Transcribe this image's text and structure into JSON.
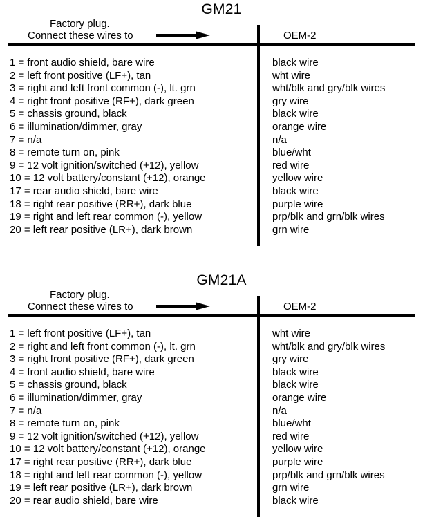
{
  "page": {
    "background_color": "#ffffff",
    "text_color": "#000000",
    "rule_color": "#000000"
  },
  "charts": [
    {
      "id": "gm21",
      "title": "GM21",
      "header": {
        "left_line1": "Factory plug.",
        "left_line2": "Connect these wires to",
        "arrow_icon": "right-arrow-icon",
        "right_label": "OEM-2"
      },
      "columns": [
        "Connect these wires to",
        "OEM-2"
      ],
      "rows": [
        {
          "pin": "1",
          "factory": "1 = front audio shield, bare wire",
          "oem": "black wire"
        },
        {
          "pin": "2",
          "factory": "2 = left front positive (LF+), tan",
          "oem": "wht wire"
        },
        {
          "pin": "3",
          "factory": "3 = right and left front common (-), lt. grn",
          "oem": "wht/blk and gry/blk wires"
        },
        {
          "pin": "4",
          "factory": "4 = right front positive (RF+), dark green",
          "oem": "gry wire"
        },
        {
          "pin": "5",
          "factory": "5 = chassis ground, black",
          "oem": "black wire"
        },
        {
          "pin": "6",
          "factory": "6 = illumination/dimmer, gray",
          "oem": "orange wire"
        },
        {
          "pin": "7",
          "factory": "7 = n/a",
          "oem": "n/a"
        },
        {
          "pin": "8",
          "factory": "8 = remote turn on, pink",
          "oem": "blue/wht"
        },
        {
          "pin": "9",
          "factory": "9 = 12 volt ignition/switched (+12), yellow",
          "oem": "red wire"
        },
        {
          "pin": "10",
          "factory": "10 = 12 volt battery/constant (+12), orange",
          "oem": "yellow wire"
        },
        {
          "pin": "17",
          "factory": "17 = rear audio shield, bare wire",
          "oem": "black wire"
        },
        {
          "pin": "18",
          "factory": "18 = right rear positive (RR+), dark blue",
          "oem": "purple wire"
        },
        {
          "pin": "19",
          "factory": "19 = right and left rear common (-), yellow",
          "oem": "prp/blk and grn/blk wires"
        },
        {
          "pin": "20",
          "factory": "20 = left rear positive (LR+), dark brown",
          "oem": "grn wire"
        }
      ]
    },
    {
      "id": "gm21a",
      "title": "GM21A",
      "header": {
        "left_line1": "Factory plug.",
        "left_line2": "Connect these wires to",
        "arrow_icon": "right-arrow-icon",
        "right_label": "OEM-2"
      },
      "columns": [
        "Connect these wires to",
        "OEM-2"
      ],
      "rows": [
        {
          "pin": "1",
          "factory": "1 = left front positive (LF+), tan",
          "oem": "wht wire"
        },
        {
          "pin": "2",
          "factory": "2 = right and left front common (-), lt. grn",
          "oem": "wht/blk and gry/blk wires"
        },
        {
          "pin": "3",
          "factory": "3 = right front positive (RF+), dark green",
          "oem": "gry wire"
        },
        {
          "pin": "4",
          "factory": "4 = front audio shield, bare wire",
          "oem": "black wire"
        },
        {
          "pin": "5",
          "factory": "5 = chassis ground, black",
          "oem": "black wire"
        },
        {
          "pin": "6",
          "factory": "6 = illumination/dimmer, gray",
          "oem": "orange wire"
        },
        {
          "pin": "7",
          "factory": "7 = n/a",
          "oem": "n/a"
        },
        {
          "pin": "8",
          "factory": "8 = remote turn on, pink",
          "oem": "blue/wht"
        },
        {
          "pin": "9",
          "factory": "9 = 12 volt ignition/switched (+12), yellow",
          "oem": "red wire"
        },
        {
          "pin": "10",
          "factory": "10 = 12 volt battery/constant (+12), orange",
          "oem": "yellow wire"
        },
        {
          "pin": "17",
          "factory": "17 = right rear positive (RR+), dark blue",
          "oem": "purple wire"
        },
        {
          "pin": "18",
          "factory": "18 = right and left rear common (-), yellow",
          "oem": "prp/blk and grn/blk wires"
        },
        {
          "pin": "19",
          "factory": "19 = left rear positive (LR+), dark brown",
          "oem": "grn wire"
        },
        {
          "pin": "20",
          "factory": "20 = rear audio shield, bare wire",
          "oem": "black wire"
        }
      ]
    }
  ]
}
